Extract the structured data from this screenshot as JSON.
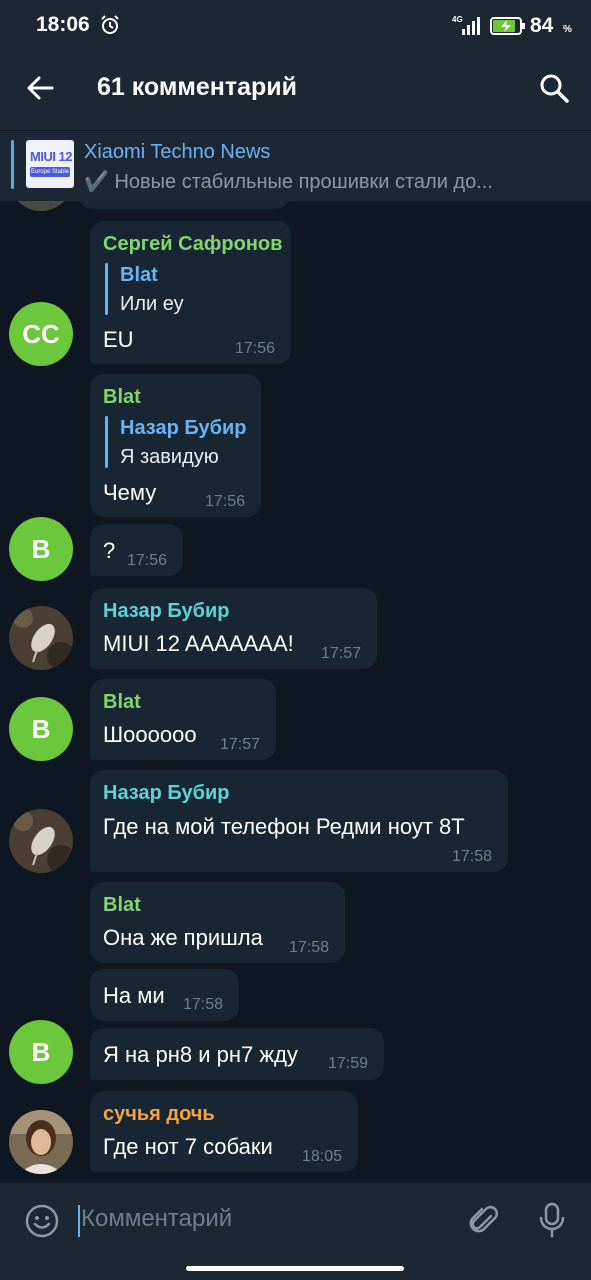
{
  "status_bar": {
    "time": "18:06",
    "network": "4G",
    "battery_percent": "84",
    "percent_sign": "%"
  },
  "header": {
    "title": "61 комментарий",
    "back_icon": "arrow-left-icon",
    "search_icon": "search-icon"
  },
  "pinned": {
    "channel": "Xiaomi Techno News",
    "preview": "✔️ Новые стабильные прошивки стали до...",
    "thumb_line1": "MIUI 12",
    "thumb_line2": "Europe Stable"
  },
  "messages": [
    {
      "sender": "Сергей Сафронов",
      "reply_name": "Blat",
      "reply_text": "Или еу",
      "text": "EU",
      "time": "17:56",
      "avatar": "СС"
    },
    {
      "sender": "Blat",
      "reply_name": "Назар Бубир",
      "reply_text": "Я завидую",
      "text": "Чему",
      "time": "17:56"
    },
    {
      "text": "?",
      "time": "17:56",
      "avatar": "B"
    },
    {
      "sender": "Назар Бубир",
      "text": "MIUI 12 AAAAAAA!",
      "time": "17:57"
    },
    {
      "sender": "Blat",
      "text": "Шоооооо",
      "time": "17:57",
      "avatar": "B"
    },
    {
      "sender": "Назар Бубир",
      "text": "Где на мой телефон Редми ноут 8Т",
      "time": "17:58"
    },
    {
      "sender": "Blat",
      "text": "Она же пришла",
      "time": "17:58"
    },
    {
      "text": "На ми",
      "time": "17:58"
    },
    {
      "text": "Я на рн8 и рн7 жду",
      "time": "17:59",
      "avatar": "B"
    },
    {
      "sender": "сучья дочь",
      "text": "Где нот 7 собаки",
      "time": "18:05"
    }
  ],
  "input": {
    "placeholder": "Комментарий"
  },
  "colors": {
    "background": "#0e1621",
    "bar": "#1c2733",
    "bubble": "#182533",
    "accent": "#6ab3f3"
  }
}
